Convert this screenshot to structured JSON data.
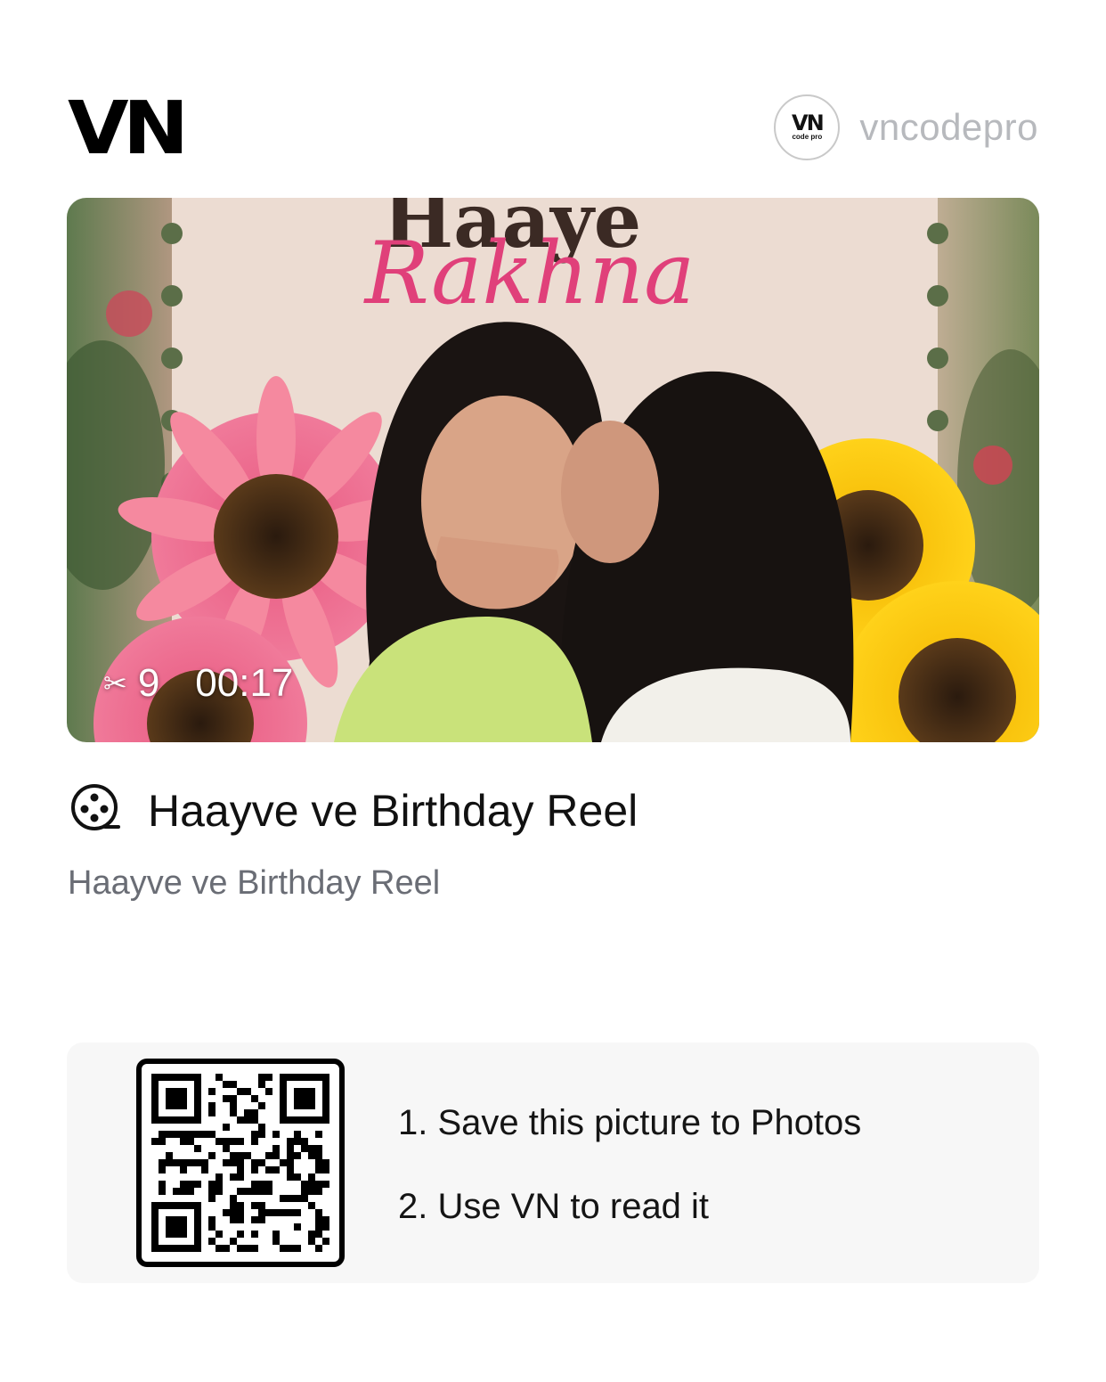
{
  "header": {
    "logo": "VN",
    "avatar": {
      "main": "VN",
      "sub": "code pro"
    },
    "username": "vncodepro"
  },
  "cover": {
    "overlay_title_top": "Haaye",
    "overlay_title_script": "Rakhna",
    "clip_count": "9",
    "duration": "00:17"
  },
  "template": {
    "title": "Haayve ve Birthday Reel",
    "subtitle": "Haayve ve Birthday Reel"
  },
  "qr_card": {
    "steps": [
      "1. Save this picture to Photos",
      "2. Use VN to read it"
    ]
  },
  "colors": {
    "username": "#b7b9bd",
    "subtitle": "#6a6d75",
    "card_background": "#f7f7f7",
    "script_pink": "#e0407a"
  },
  "icons": {
    "clip": "scissors-icon",
    "template": "film-reel-icon"
  }
}
